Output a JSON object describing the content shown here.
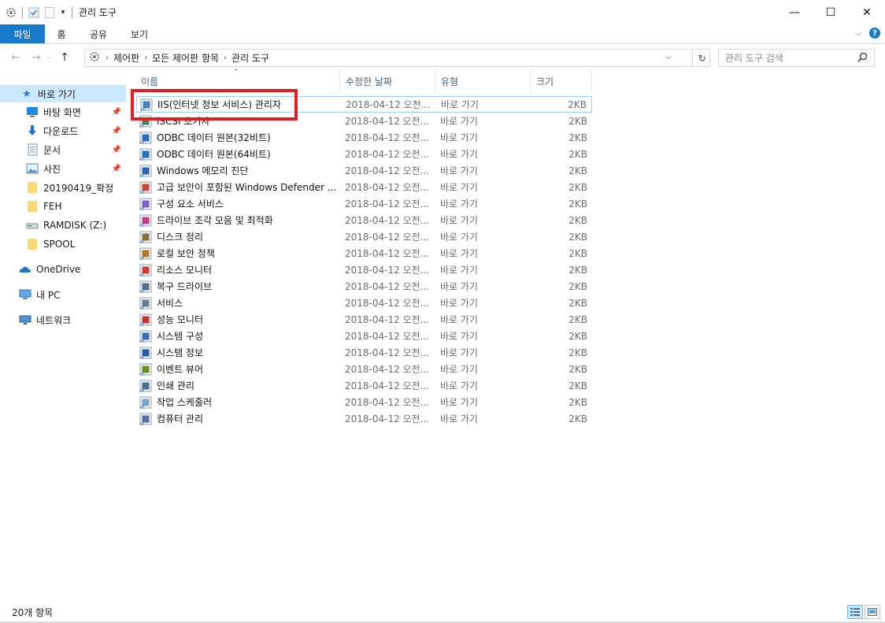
{
  "window": {
    "title": "관리 도구",
    "controls": {
      "minimize": "—",
      "maximize": "☐",
      "close": "✕"
    }
  },
  "ribbon": {
    "tabs": [
      "파일",
      "홈",
      "공유",
      "보기"
    ]
  },
  "address": {
    "crumbs": [
      "제어판",
      "모든 제어판 항목",
      "관리 도구"
    ],
    "search_placeholder": "관리 도구 검색"
  },
  "nav": {
    "quick_access": "바로 가기",
    "pinned": [
      "바탕 화면",
      "다운로드",
      "문서",
      "사진"
    ],
    "folders": [
      "20190419_확정",
      "FEH",
      "RAMDISK (Z:)",
      "SPOOL"
    ],
    "onedrive": "OneDrive",
    "this_pc": "내 PC",
    "network": "네트워크"
  },
  "columns": {
    "name": "이름",
    "date": "수정한 날짜",
    "type": "유형",
    "size": "크기"
  },
  "files": [
    {
      "name": "IIS(인터넷 정보 서비스) 관리자",
      "date": "2018-04-12 오전...",
      "type": "바로 가기",
      "size": "2KB",
      "icon": "iis-icon"
    },
    {
      "name": "iSCSI 초기자",
      "date": "2018-04-12 오전...",
      "type": "바로 가기",
      "size": "2KB",
      "icon": "iscsi-icon"
    },
    {
      "name": "ODBC 데이터 원본(32비트)",
      "date": "2018-04-12 오전...",
      "type": "바로 가기",
      "size": "2KB",
      "icon": "odbc-icon"
    },
    {
      "name": "ODBC 데이터 원본(64비트)",
      "date": "2018-04-12 오전...",
      "type": "바로 가기",
      "size": "2KB",
      "icon": "odbc-icon"
    },
    {
      "name": "Windows 메모리 진단",
      "date": "2018-04-12 오전...",
      "type": "바로 가기",
      "size": "2KB",
      "icon": "memory-diagnostic-icon"
    },
    {
      "name": "고급 보안이 포함된 Windows Defender ...",
      "date": "2018-04-12 오전...",
      "type": "바로 가기",
      "size": "2KB",
      "icon": "firewall-icon"
    },
    {
      "name": "구성 요소 서비스",
      "date": "2018-04-12 오전...",
      "type": "바로 가기",
      "size": "2KB",
      "icon": "component-services-icon"
    },
    {
      "name": "드라이브 조각 모음 및 최적화",
      "date": "2018-04-12 오전...",
      "type": "바로 가기",
      "size": "2KB",
      "icon": "defrag-icon"
    },
    {
      "name": "디스크 정리",
      "date": "2018-04-12 오전...",
      "type": "바로 가기",
      "size": "2KB",
      "icon": "disk-cleanup-icon"
    },
    {
      "name": "로컬 보안 정책",
      "date": "2018-04-12 오전...",
      "type": "바로 가기",
      "size": "2KB",
      "icon": "security-policy-icon"
    },
    {
      "name": "리소스 모니터",
      "date": "2018-04-12 오전...",
      "type": "바로 가기",
      "size": "2KB",
      "icon": "resource-monitor-icon"
    },
    {
      "name": "복구 드라이브",
      "date": "2018-04-12 오전...",
      "type": "바로 가기",
      "size": "2KB",
      "icon": "recovery-drive-icon"
    },
    {
      "name": "서비스",
      "date": "2018-04-12 오전...",
      "type": "바로 가기",
      "size": "2KB",
      "icon": "services-icon"
    },
    {
      "name": "성능 모니터",
      "date": "2018-04-12 오전...",
      "type": "바로 가기",
      "size": "2KB",
      "icon": "performance-monitor-icon"
    },
    {
      "name": "시스템 구성",
      "date": "2018-04-12 오전...",
      "type": "바로 가기",
      "size": "2KB",
      "icon": "system-config-icon"
    },
    {
      "name": "시스템 정보",
      "date": "2018-04-12 오전...",
      "type": "바로 가기",
      "size": "2KB",
      "icon": "system-info-icon"
    },
    {
      "name": "이벤트 뷰어",
      "date": "2018-04-12 오전...",
      "type": "바로 가기",
      "size": "2KB",
      "icon": "event-viewer-icon"
    },
    {
      "name": "인쇄 관리",
      "date": "2018-04-12 오전...",
      "type": "바로 가기",
      "size": "2KB",
      "icon": "print-management-icon"
    },
    {
      "name": "작업 스케줄러",
      "date": "2018-04-12 오전...",
      "type": "바로 가기",
      "size": "2KB",
      "icon": "task-scheduler-icon"
    },
    {
      "name": "컴퓨터 관리",
      "date": "2018-04-12 오전...",
      "type": "바로 가기",
      "size": "2KB",
      "icon": "computer-management-icon"
    }
  ],
  "status": {
    "item_count": "20개 항목"
  },
  "colors": {
    "accent": "#1979ca",
    "selection": "#cce8ff",
    "highlight": "#e01e26"
  }
}
